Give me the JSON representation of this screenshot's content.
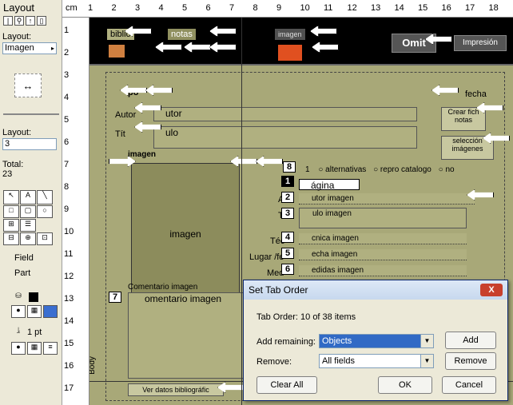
{
  "status": {
    "title": "Layout",
    "layout_label": "Layout:",
    "layout_value": "Imagen",
    "layout_num_label": "Layout:",
    "layout_num_value": "3",
    "total_label": "Total:",
    "total_value": "23",
    "field_label": "Field",
    "part_label": "Part",
    "pen_size": "1 pt"
  },
  "ruler": {
    "unit": "cm",
    "marks": [
      "1",
      "2",
      "3",
      "4",
      "5",
      "6",
      "7",
      "8",
      "9",
      "10",
      "11",
      "12",
      "13",
      "14",
      "15",
      "16",
      "17",
      "18"
    ],
    "vmarks": [
      "1",
      "2",
      "3",
      "4",
      "5",
      "6",
      "7",
      "8",
      "9",
      "10",
      "11",
      "12",
      "13",
      "14",
      "15",
      "16",
      "17"
    ]
  },
  "header": {
    "tabs": [
      "biblio",
      "notas",
      "imagen"
    ],
    "omit_label": "Omit",
    "print_label": "Impresión"
  },
  "body": {
    "part_label": "Body",
    "fecha": "fecha",
    "crear_btn": "Crear fich notas",
    "seleccion_btn": "selección imágenes",
    "autor": "Autor",
    "autor_field": "utor",
    "titulo": "Tít",
    "titulo_field": "ulo",
    "imagen_label": "imagen",
    "imagen_box": "imagen",
    "radio_options": [
      "1",
      "alternativas",
      "repro catalogo",
      "no"
    ],
    "pagina_field": "ágina",
    "autor_imagen_label": "A",
    "autor_imagen_field": "utor imagen",
    "titulo_imagen_label": "T",
    "titulo_imagen_field": "ulo imagen",
    "tecnica_label": "Téc",
    "tecnica_field": "cnica imagen",
    "lugar_label": "Lugar /fe",
    "fecha_imagen_field": "echa imagen",
    "medidas_label": "Med",
    "medidas_field": "edidas imagen",
    "comentario_label": "Comentario imagen",
    "comentario_field": "omentario imagen",
    "ver_datos_btn": "Ver datos bibliográfic",
    "tab_badges": [
      "8",
      "1",
      "2",
      "3",
      "4",
      "5",
      "6",
      "7"
    ],
    "po_text": "po"
  },
  "dialog": {
    "title": "Set Tab Order",
    "close_label": "X",
    "tab_order_text": "Tab Order: 10 of 38 items",
    "add_remaining_label": "Add remaining:",
    "add_remaining_value": "Objects",
    "add_label": "Add",
    "remove_label": "Remove:",
    "remove_value": "All fields",
    "remove_btn": "Remove",
    "clear_all": "Clear All",
    "ok": "OK",
    "cancel": "Cancel"
  }
}
